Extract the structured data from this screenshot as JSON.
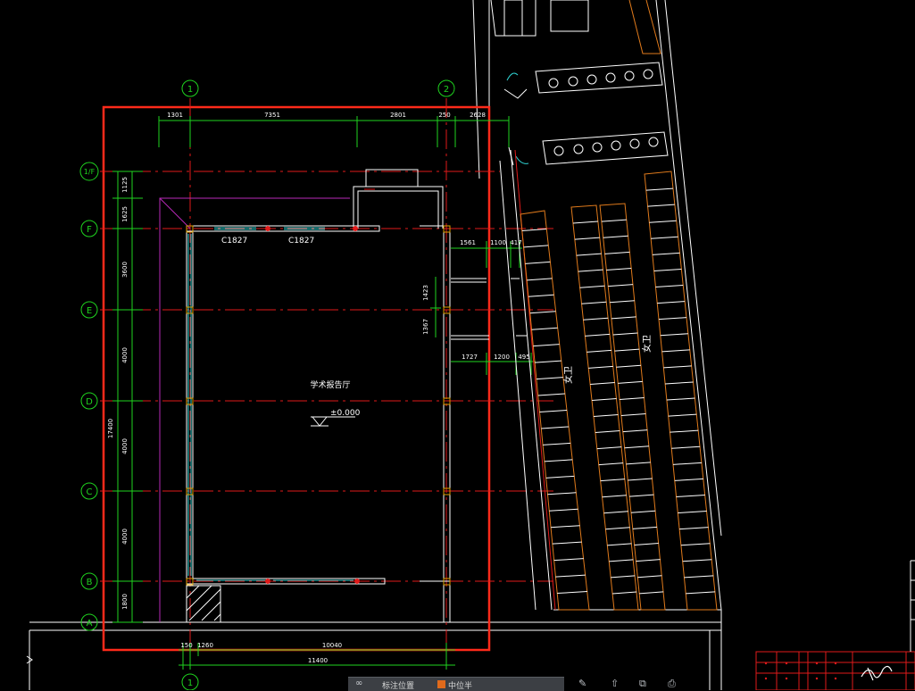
{
  "drawing": {
    "grid_axes_vertical": [
      "1",
      "2"
    ],
    "grid_axes_horizontal": [
      "1/F",
      "F",
      "E",
      "D",
      "C",
      "B",
      "A"
    ],
    "top_dimensions": [
      "1301",
      "7351",
      "2801",
      "250",
      "2628"
    ],
    "bottom_dimensions": [
      "150",
      "1260",
      "10040"
    ],
    "overall_bottom_dimension": "11400",
    "left_dimensions": [
      "1125",
      "1625",
      "3600",
      "4000",
      "4000",
      "4000",
      "1800"
    ],
    "left_overall_dimension": "17400",
    "window_labels": [
      "C1827",
      "C1827"
    ],
    "room_name": "学术报告厅",
    "elevation": "±0.000",
    "right_room_labels": [
      "女卫",
      "女卫"
    ],
    "right_dims_upper": [
      "1561",
      "1100",
      "417"
    ],
    "right_dims_lower": [
      "1727",
      "1200",
      "495"
    ],
    "right_dims_vertical": [
      "1423",
      "1367"
    ]
  },
  "toolbar": {
    "label_1": "标注位置",
    "label_2": "中位半"
  },
  "right_tools": [
    "✎",
    "⇧",
    "⧉",
    "⎙"
  ],
  "colors": {
    "background": "#000000",
    "selection_frame": "#ff2a1a",
    "axis_line": "#e01a1a",
    "dimension": "#1fd41f",
    "wall": "#ffffff",
    "window": "#2fd3d3",
    "column": "#e0a000",
    "purple_line": "#b82ab8",
    "orange": "#e07a1b"
  }
}
